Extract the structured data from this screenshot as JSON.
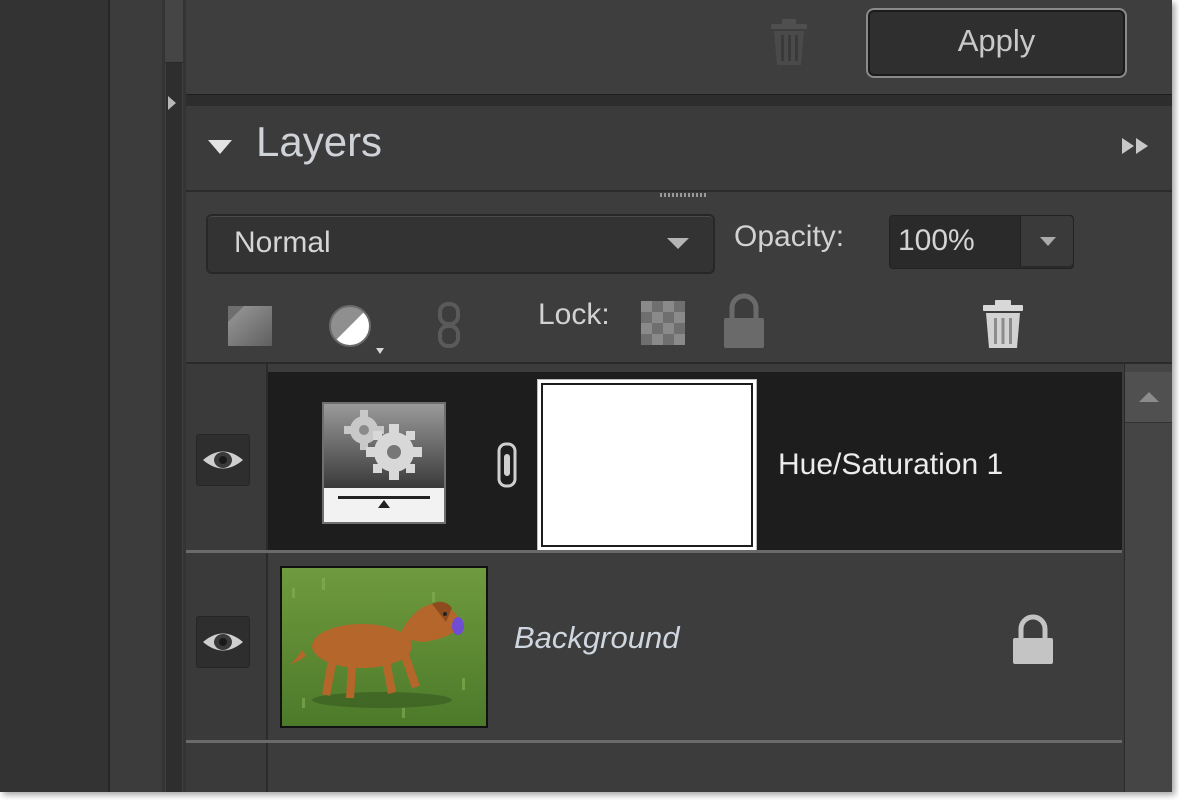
{
  "top": {
    "apply_label": "Apply"
  },
  "layers_panel": {
    "title": "Layers",
    "blend_mode": "Normal",
    "opacity_label": "Opacity:",
    "opacity_value": "100%",
    "lock_label": "Lock:"
  },
  "layers": [
    {
      "name": "Hue/Saturation 1",
      "visible": true,
      "selected": true,
      "type": "adjustment"
    },
    {
      "name": "Background",
      "visible": true,
      "selected": false,
      "locked": true,
      "type": "image"
    }
  ],
  "colors": {
    "panel_bg": "#3d3d3d",
    "selected_row": "#1d1d1d",
    "text_light": "#ececec",
    "accent_title": "#cfd3d8"
  },
  "icons": [
    "trash-icon",
    "new-layer-icon",
    "adjustment-layer-icon",
    "link-icon",
    "lock-transparent-icon",
    "lock-icon",
    "eye-icon",
    "fast-forward-icon"
  ]
}
